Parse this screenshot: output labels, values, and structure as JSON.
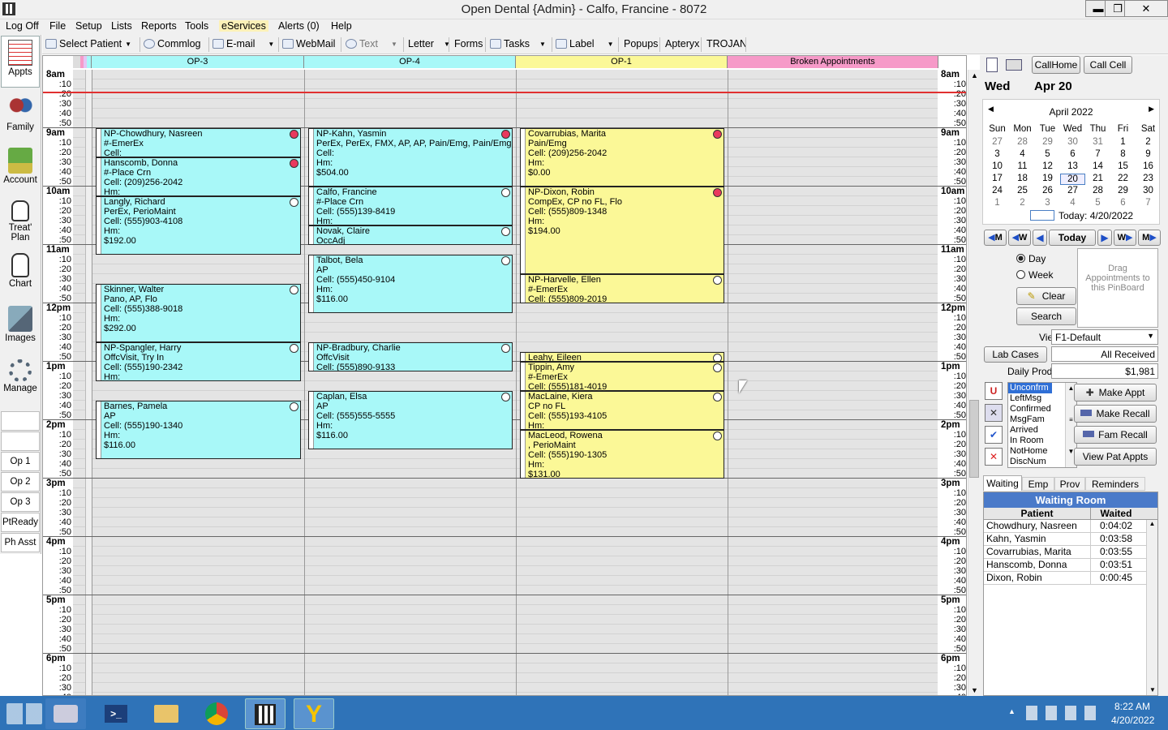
{
  "window": {
    "title": "Open Dental {Admin} - Calfo, Francine - 8072",
    "minimize": "▬",
    "restore": "❐",
    "close": "✕"
  },
  "menu": [
    "Log Off",
    "File",
    "Setup",
    "Lists",
    "Reports",
    "Tools",
    "eServices",
    "Alerts (0)",
    "Help"
  ],
  "toolbar": [
    "Select Patient",
    "Commlog",
    "E-mail",
    "WebMail",
    "Text",
    "Letter",
    "Forms",
    "Tasks",
    "Label",
    "Popups",
    "Apteryx",
    "TROJAN"
  ],
  "modules": [
    "Appts",
    "Family",
    "Account",
    "Treat' Plan",
    "Chart",
    "Images",
    "Manage"
  ],
  "op_buttons": [
    "Op 1",
    "Op 2",
    "Op 3",
    "PtReady",
    "Ph Asst"
  ],
  "columns": [
    "OP-3",
    "OP-4",
    "OP-1",
    "Broken Appointments"
  ],
  "hours": [
    "8am",
    "9am",
    "10am",
    "11am",
    "12pm",
    "1pm",
    "2pm",
    "3pm",
    "4pm",
    "5pm",
    "6pm"
  ],
  "minutes": [
    ":10",
    ":20",
    ":30",
    ":40",
    ":50"
  ],
  "appointments": [
    {
      "col": 0,
      "start": 60,
      "len": 3,
      "color": "cy",
      "dot": "red",
      "lines": [
        "NP-Chowdhury, Nasreen",
        "#-EmerEx",
        "Cell:"
      ]
    },
    {
      "col": 0,
      "start": 90,
      "len": 4,
      "color": "cy",
      "dot": "red",
      "lines": [
        "Hanscomb, Donna",
        "#-Place Crn",
        "Cell: (209)256-2042",
        "Hm:"
      ]
    },
    {
      "col": 0,
      "start": 130,
      "len": 6,
      "color": "cy",
      "dot": "white",
      "lines": [
        "Langly, Richard",
        "PerEx, PerioMaint",
        "Cell: (555)903-4108",
        "Hm:",
        "$192.00"
      ]
    },
    {
      "col": 0,
      "start": 220,
      "len": 6,
      "color": "cy",
      "dot": "white",
      "lines": [
        "Skinner, Walter",
        "Pano, AP, Flo",
        "Cell: (555)388-9018",
        "Hm:",
        "$292.00"
      ]
    },
    {
      "col": 0,
      "start": 280,
      "len": 4,
      "color": "cy",
      "dot": "white",
      "lines": [
        "NP-Spangler, Harry",
        "OffcVisit, Try In",
        "Cell: (555)190-2342",
        "Hm:"
      ]
    },
    {
      "col": 0,
      "start": 340,
      "len": 6,
      "color": "cy",
      "dot": "white",
      "lines": [
        "Barnes, Pamela",
        "AP",
        "Cell: (555)190-1340",
        "Hm:",
        "$116.00"
      ]
    },
    {
      "col": 1,
      "start": 60,
      "len": 6,
      "color": "cy",
      "dot": "red",
      "lines": [
        "NP-Kahn, Yasmin",
        "PerEx, PerEx, FMX, AP, AP, Pain/Emg, Pain/Emg",
        "Cell:",
        "Hm:",
        "$504.00"
      ]
    },
    {
      "col": 1,
      "start": 120,
      "len": 4,
      "color": "cy",
      "dot": "white",
      "lines": [
        "Calfo, Francine",
        "#-Place Crn",
        "Cell: (555)139-8419",
        "Hm:"
      ]
    },
    {
      "col": 1,
      "start": 160,
      "len": 2,
      "color": "cy",
      "dot": "white",
      "lines": [
        "Novak, Claire",
        "OccAdj"
      ]
    },
    {
      "col": 1,
      "start": 190,
      "len": 6,
      "color": "cy",
      "dot": "white",
      "lines": [
        "Talbot, Bela",
        "AP",
        "Cell: (555)450-9104",
        "Hm:",
        "$116.00"
      ]
    },
    {
      "col": 1,
      "start": 280,
      "len": 3,
      "color": "cy",
      "dot": "white",
      "lines": [
        "NP-Bradbury, Charlie",
        "OffcVisit",
        "Cell: (555)890-9133"
      ]
    },
    {
      "col": 1,
      "start": 330,
      "len": 6,
      "color": "cy",
      "dot": "white",
      "lines": [
        "Caplan, Elsa",
        "AP",
        "Cell: (555)555-5555",
        "Hm:",
        "$116.00"
      ]
    },
    {
      "col": 2,
      "start": 60,
      "len": 6,
      "color": "ye",
      "dot": "red",
      "lines": [
        "Covarrubias, Marita",
        "Pain/Emg",
        "Cell: (209)256-2042",
        "Hm:",
        "$0.00"
      ]
    },
    {
      "col": 2,
      "start": 120,
      "len": 9,
      "color": "ye",
      "dot": "red",
      "lines": [
        "NP-Dixon, Robin",
        "CompEx, CP no FL, Flo",
        "Cell: (555)809-1348",
        "Hm:",
        "$194.00"
      ]
    },
    {
      "col": 2,
      "start": 210,
      "len": 3,
      "color": "ye",
      "dot": "white",
      "lines": [
        "NP-Harvelle, Ellen",
        "#-EmerEx",
        "Cell: (555)809-2019"
      ]
    },
    {
      "col": 2,
      "start": 290,
      "len": 1,
      "color": "ye",
      "dot": "white",
      "lines": [
        "Leahy, Eileen"
      ]
    },
    {
      "col": 2,
      "start": 300,
      "len": 3,
      "color": "ye",
      "dot": "white",
      "lines": [
        "Tippin, Amy",
        "#-EmerEx",
        "Cell: (555)181-4019"
      ]
    },
    {
      "col": 2,
      "start": 330,
      "len": 4,
      "color": "ye",
      "dot": "white",
      "lines": [
        "MacLaine, Kiera",
        "CP no FL",
        "Cell: (555)193-4105",
        "Hm:"
      ]
    },
    {
      "col": 2,
      "start": 370,
      "len": 5,
      "color": "ye",
      "dot": "white",
      "lines": [
        "MacLeod, Rowena",
        ", PerioMaint",
        "Cell: (555)190-1305",
        "Hm:",
        "$131.00"
      ]
    }
  ],
  "right": {
    "callhome": "CallHome",
    "callcell": "Call Cell",
    "day": "Wed",
    "date": "Apr 20",
    "month": "April 2022",
    "dow": [
      "Sun",
      "Mon",
      "Tue",
      "Wed",
      "Thu",
      "Fri",
      "Sat"
    ],
    "cal": [
      [
        "27",
        "28",
        "29",
        "30",
        "31",
        "1",
        "2"
      ],
      [
        "3",
        "4",
        "5",
        "6",
        "7",
        "8",
        "9"
      ],
      [
        "10",
        "11",
        "12",
        "13",
        "14",
        "15",
        "16"
      ],
      [
        "17",
        "18",
        "19",
        "20",
        "21",
        "22",
        "23"
      ],
      [
        "24",
        "25",
        "26",
        "27",
        "28",
        "29",
        "30"
      ],
      [
        "1",
        "2",
        "3",
        "4",
        "5",
        "6",
        "7"
      ]
    ],
    "today": "Today: 4/20/2022",
    "nav": [
      "M",
      "W",
      "Today",
      "W",
      "M"
    ],
    "day_opt": "Day",
    "week_opt": "Week",
    "clear": "Clear",
    "search": "Search",
    "pinboard": "Drag Appointments to this PinBoard",
    "view_label": "View",
    "view_value": "F1-Default",
    "lab_cases": "Lab Cases",
    "all_received": "All Received",
    "daily_prod": "Daily Prod",
    "daily_prod_value": "$1,981",
    "confirm_list": [
      "Unconfrm",
      "LeftMsg",
      "Confirmed",
      "MsgFam",
      "Arrived",
      "In Room",
      "NotHome",
      "DiscNum"
    ],
    "make_appt": "Make Appt",
    "make_recall": "Make Recall",
    "fam_recall": "Fam Recall",
    "view_pat_appts": "View Pat Appts",
    "tabs": [
      "Waiting",
      "Emp",
      "Prov",
      "Reminders"
    ],
    "waiting_title": "Waiting Room",
    "waiting_cols": [
      "Patient",
      "Waited"
    ],
    "waiting": [
      [
        "Chowdhury, Nasreen",
        "0:04:02"
      ],
      [
        "Kahn, Yasmin",
        "0:03:58"
      ],
      [
        "Covarrubias, Marita",
        "0:03:55"
      ],
      [
        "Hanscomb, Donna",
        "0:03:51"
      ],
      [
        "Dixon, Robin",
        "0:00:45"
      ]
    ]
  },
  "tray": {
    "time": "8:22 AM",
    "date": "4/20/2022"
  },
  "colors": {
    "cyan": "#a8f8f8",
    "yellow": "#fbf897",
    "broken": "#f69ac8",
    "op1hdr": "#fbf897",
    "ophdr": "#a8f8f8",
    "redline": "#e03030"
  }
}
